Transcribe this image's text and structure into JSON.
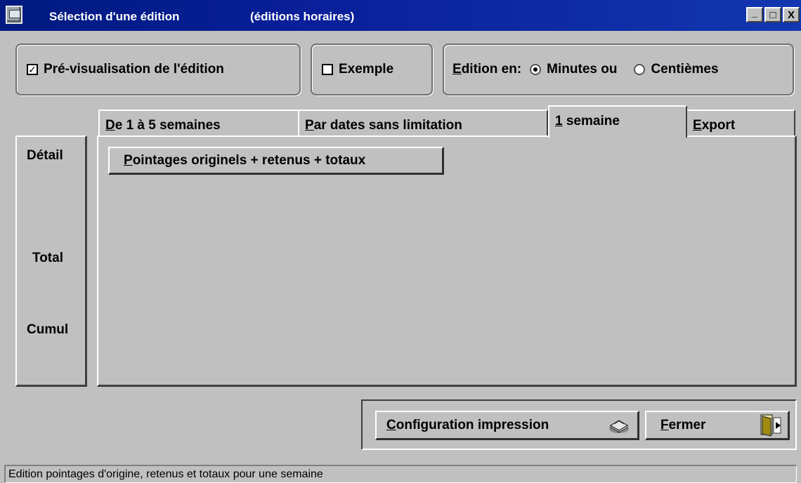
{
  "window": {
    "title": "Sélection d'une édition",
    "subtitle": "(éditions horaires)",
    "controls": {
      "minimize": "_",
      "maximize": "□",
      "close": "X"
    }
  },
  "options": {
    "preview": {
      "label": "Pré-visualisation de l'édition",
      "checked": true,
      "mark": "✓"
    },
    "example": {
      "label": "Exemple",
      "checked": false
    },
    "edition_en": {
      "prefix_u": "E",
      "prefix_rest": "dition en:",
      "choices": [
        {
          "label": "Minutes ou",
          "selected": true
        },
        {
          "label": "Centièmes",
          "selected": false
        }
      ]
    }
  },
  "tabs": [
    {
      "u": "D",
      "rest": "e 1 à 5 semaines",
      "active": false
    },
    {
      "u": "P",
      "rest": "ar dates sans limitation",
      "active": false
    },
    {
      "u": "1",
      "rest": " semaine",
      "active": true
    },
    {
      "u": "E",
      "rest": "xport",
      "active": false
    }
  ],
  "side": {
    "detail": "Détail",
    "total": "Total",
    "cumul": "Cumul"
  },
  "panel": {
    "report_button": {
      "u": "P",
      "rest": "ointages originels + retenus + totaux"
    }
  },
  "footer": {
    "config_button": {
      "u": "C",
      "rest": "onfiguration impression"
    },
    "close_button": {
      "u": "F",
      "rest": "ermer"
    }
  },
  "status": "Edition pointages d'origine, retenus et totaux pour une semaine"
}
